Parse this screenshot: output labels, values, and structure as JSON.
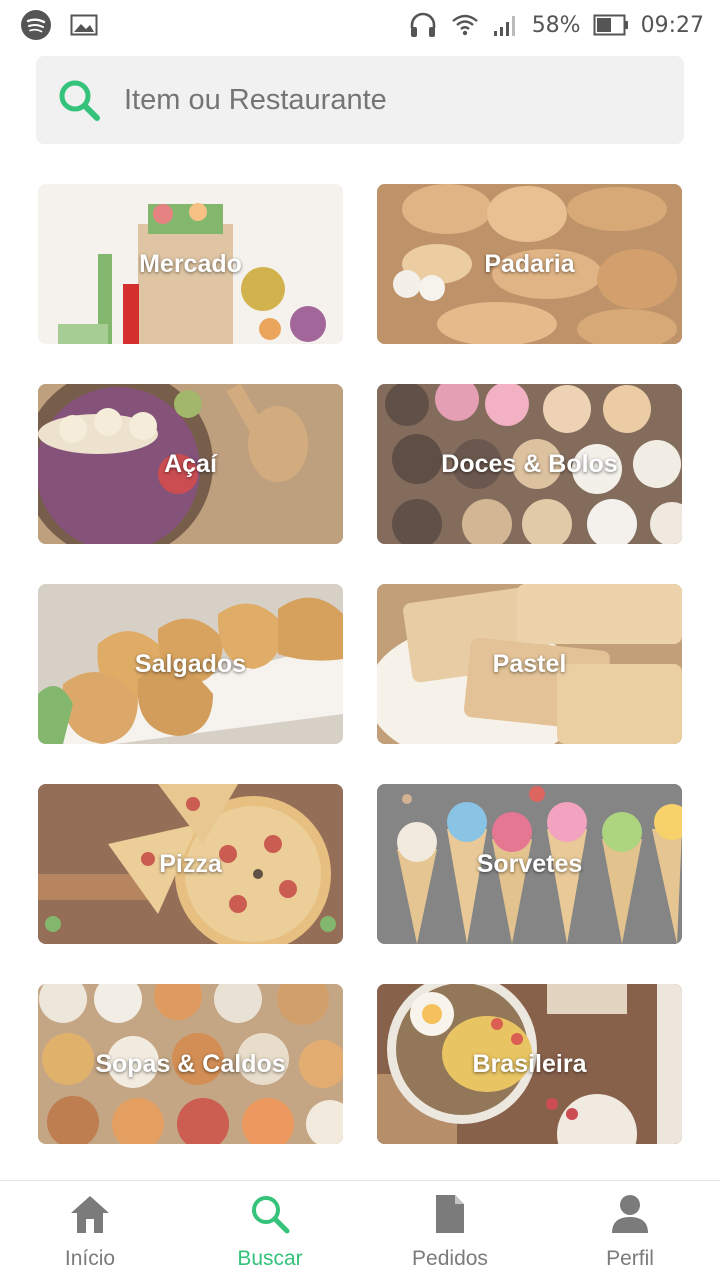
{
  "status_bar": {
    "battery": "58%",
    "time": "09:27",
    "left_icons": [
      "spotify-icon",
      "image-icon"
    ],
    "right_icons": [
      "headphones-icon",
      "wifi-icon",
      "signal-icon",
      "battery-icon"
    ]
  },
  "search": {
    "placeholder": "Item ou Restaurante",
    "icon": "search-icon",
    "icon_color": "#35c27a"
  },
  "categories": [
    {
      "label": "Mercado"
    },
    {
      "label": "Padaria"
    },
    {
      "label": "Açaí"
    },
    {
      "label": "Doces & Bolos"
    },
    {
      "label": "Salgados"
    },
    {
      "label": "Pastel"
    },
    {
      "label": "Pizza"
    },
    {
      "label": "Sorvetes"
    },
    {
      "label": "Sopas & Caldos"
    },
    {
      "label": "Brasileira"
    }
  ],
  "bottom_nav": {
    "active": "Buscar",
    "accent": "#35c27a",
    "items": [
      {
        "label": "Início",
        "icon": "home-icon"
      },
      {
        "label": "Buscar",
        "icon": "search-icon"
      },
      {
        "label": "Pedidos",
        "icon": "document-icon"
      },
      {
        "label": "Perfil",
        "icon": "person-icon"
      }
    ]
  }
}
